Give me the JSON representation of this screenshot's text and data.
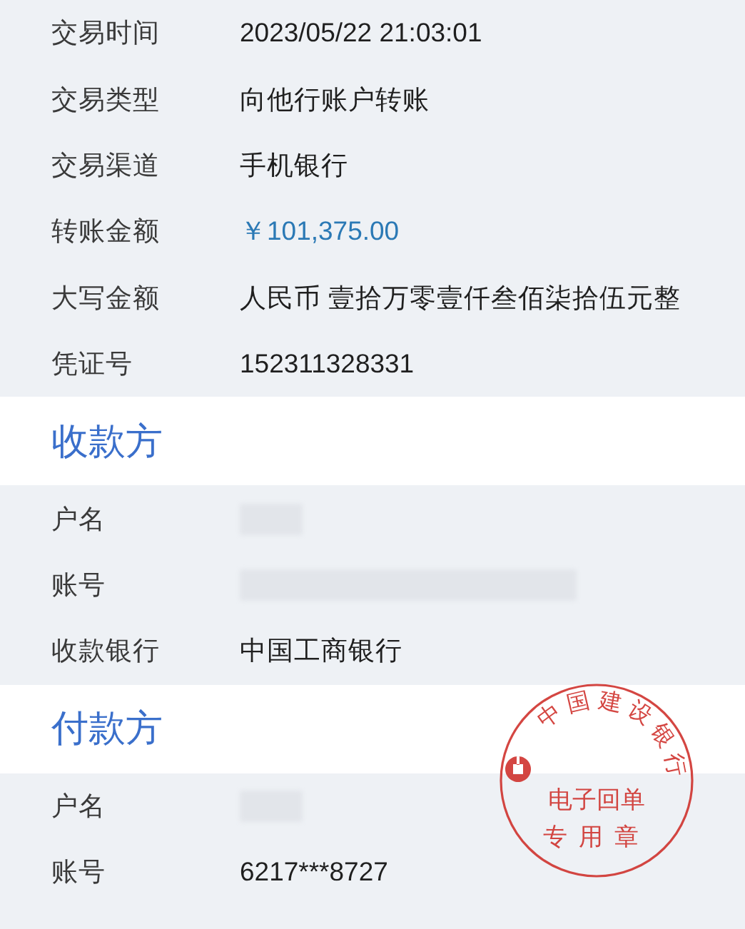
{
  "details": [
    {
      "label": "交易时间",
      "value": "2023/05/22 21:03:01",
      "kind": "text"
    },
    {
      "label": "交易类型",
      "value": "向他行账户转账",
      "kind": "text"
    },
    {
      "label": "交易渠道",
      "value": "手机银行",
      "kind": "text"
    },
    {
      "label": "转账金额",
      "value": "￥101,375.00",
      "kind": "amount"
    },
    {
      "label": "大写金额",
      "value": "人民币 壹拾万零壹仟叁佰柒拾伍元整",
      "kind": "text"
    },
    {
      "label": "凭证号",
      "value": "152311328331",
      "kind": "text"
    }
  ],
  "payee": {
    "title": "收款方",
    "rows": [
      {
        "label": "户名",
        "kind": "redacted_short"
      },
      {
        "label": "账号",
        "kind": "redacted_long"
      },
      {
        "label": "收款银行",
        "value": "中国工商银行",
        "kind": "text"
      }
    ]
  },
  "payer": {
    "title": "付款方",
    "rows": [
      {
        "label": "户名",
        "kind": "redacted_short"
      },
      {
        "label": "账号",
        "value": "6217***8727",
        "kind": "text"
      }
    ]
  },
  "stamp": {
    "bank": "中国建设银行",
    "line_1": "电子回单",
    "line_2": "专用章"
  }
}
